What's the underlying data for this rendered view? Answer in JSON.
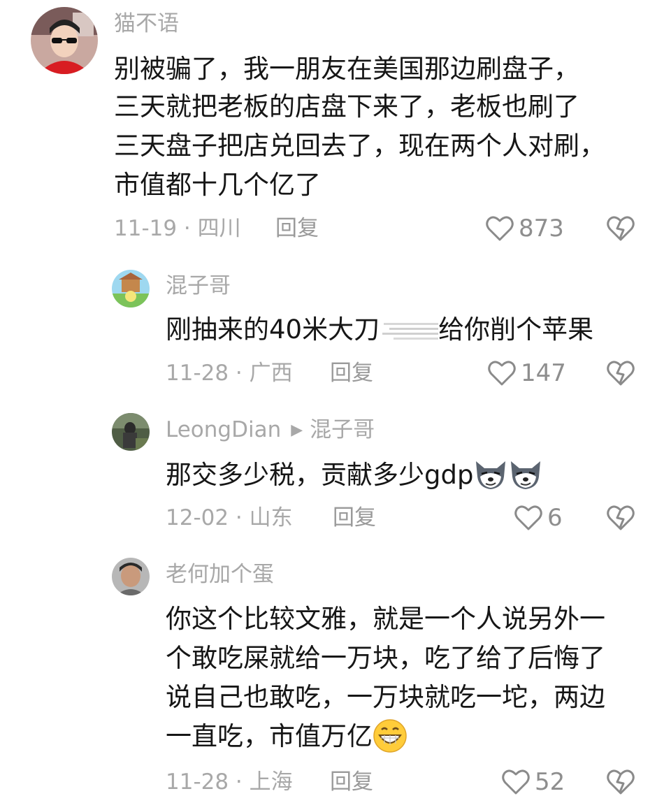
{
  "comments": [
    {
      "username": "猫不语",
      "lines": [
        "别被骗了，我一朋友在美国那边刷盘子，",
        "三天就把老板的店盘下来了，老板也刷了",
        "三天盘子把店兑回去了，现在两个人对刷，",
        "市值都十几个亿了"
      ],
      "date_location": "11-19 · 四川",
      "reply_label": "回复",
      "likes": "873"
    },
    {
      "username": "混子哥",
      "text_before": "刚抽来的40米大刀",
      "text_after": "给你削个苹果",
      "date_location": "11-28 · 广西",
      "reply_label": "回复",
      "likes": "147"
    },
    {
      "username": "LeongDian",
      "reply_to": "混子哥",
      "text": "那交多少税，贡献多少gdp",
      "date_location": "12-02 · 山东",
      "reply_label": "回复",
      "likes": "6"
    },
    {
      "username": "老何加个蛋",
      "lines": [
        "你这个比较文雅，就是一个人说另外一",
        "个敢吃屎就给一万块，吃了给了后悔了",
        "说自己也敢吃，一万块就吃一坨，两边",
        "一直吃，市值万亿"
      ],
      "date_location": "11-28 · 上海",
      "reply_label": "回复",
      "likes": "52"
    }
  ],
  "icons": {
    "like": "heart-outline-icon",
    "dislike": "broken-heart-icon",
    "reply_arrow": "triangle-right-icon",
    "emoji_wolf": "wolf-smirk-emoji",
    "emoji_grin": "grinning-face-emoji"
  },
  "colors": {
    "username": "#a8a8a8",
    "body": "#161616",
    "meta": "#a8a8a8"
  }
}
